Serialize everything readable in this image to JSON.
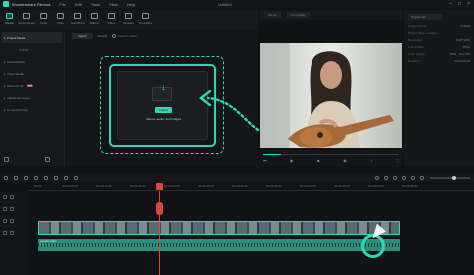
{
  "app": {
    "name": "Wondershare Filmora",
    "window_title": "Untitled"
  },
  "menu": [
    "File",
    "Edit",
    "Tools",
    "View",
    "Help"
  ],
  "toolbar": [
    {
      "label": "Media",
      "icon": "media-icon",
      "active": true
    },
    {
      "label": "Stock Media",
      "icon": "stock-media-icon"
    },
    {
      "label": "Audio",
      "icon": "audio-icon"
    },
    {
      "label": "Titles",
      "icon": "titles-icon"
    },
    {
      "label": "Transitions",
      "icon": "transitions-icon"
    },
    {
      "label": "Effects",
      "icon": "effects-icon"
    },
    {
      "label": "Filters",
      "icon": "filters-icon"
    },
    {
      "label": "Stickers",
      "icon": "stickers-icon"
    },
    {
      "label": "Templates",
      "icon": "templates-icon"
    }
  ],
  "sidebar": {
    "items": [
      {
        "label": "Project Media",
        "active": true
      },
      {
        "label": "Folder",
        "sub": true
      },
      {
        "label": "Global Media"
      },
      {
        "label": "Cloud Media"
      },
      {
        "label": "Influence Kit",
        "badge": "NEW"
      },
      {
        "label": "Adjustment Layer"
      },
      {
        "label": "Compound Clip"
      }
    ]
  },
  "media": {
    "import_label": "Import",
    "filter_label": "Default",
    "search_placeholder": "Search media",
    "import_button": "Import",
    "drop_hint": "Videos, audio, and images"
  },
  "preview": {
    "tabs": [
      "Player",
      "Full Quality"
    ],
    "progress": 0.13
  },
  "properties": {
    "tab": "Project Info",
    "rows": [
      {
        "label": "Project Name:",
        "value": "Untitled"
      },
      {
        "label": "Project Files Location:",
        "value": ""
      },
      {
        "label": "Resolution:",
        "value": "1920*1080"
      },
      {
        "label": "Frame Rate:",
        "value": "25fps"
      },
      {
        "label": "Color Space:",
        "value": "SDR - Rec.709"
      },
      {
        "label": "Duration:",
        "value": "00:00:00:00"
      }
    ]
  },
  "timeline": {
    "ticks": [
      "00:00",
      "00:00:05:00",
      "00:00:10:00",
      "00:00:15:00",
      "00:00:20:00",
      "00:00:25:00",
      "00:00:30:00",
      "00:00:35:00",
      "00:00:40:00",
      "00:00:45:00",
      "00:00:50:00",
      "00:00:55:00"
    ],
    "audio_clip_label": "pexels-video"
  },
  "colors": {
    "accent": "#2bd9b4",
    "playhead": "#e0463d",
    "background": "#111214"
  }
}
